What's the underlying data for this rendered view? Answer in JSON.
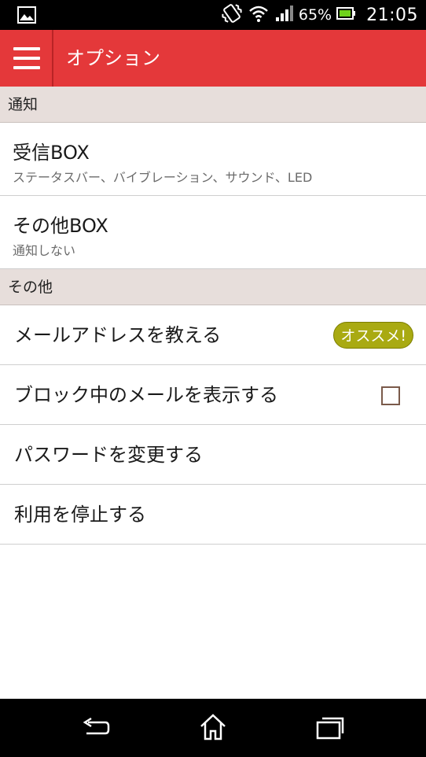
{
  "status_bar": {
    "icons": [
      "gallery-icon",
      "vibrate-icon",
      "wifi-icon",
      "signal-icon",
      "battery-icon"
    ],
    "battery": "65%",
    "time": "21:05"
  },
  "action_bar": {
    "title": "オプション",
    "color": "#e4383a"
  },
  "sections": {
    "notify": {
      "header": "通知",
      "items": [
        {
          "title": "受信BOX",
          "subtitle": "ステータスバー、バイブレーション、サウンド、LED"
        },
        {
          "title": "その他BOX",
          "subtitle": "通知しない"
        }
      ]
    },
    "other": {
      "header": "その他",
      "items": [
        {
          "title": "メールアドレスを教える",
          "badge": "オススメ!"
        },
        {
          "title": "ブロック中のメールを表示する",
          "checked": false
        },
        {
          "title": "パスワードを変更する"
        },
        {
          "title": "利用を停止する"
        }
      ]
    }
  },
  "nav_bar": {
    "icons": [
      "back-icon",
      "home-icon",
      "recent-apps-icon"
    ]
  }
}
